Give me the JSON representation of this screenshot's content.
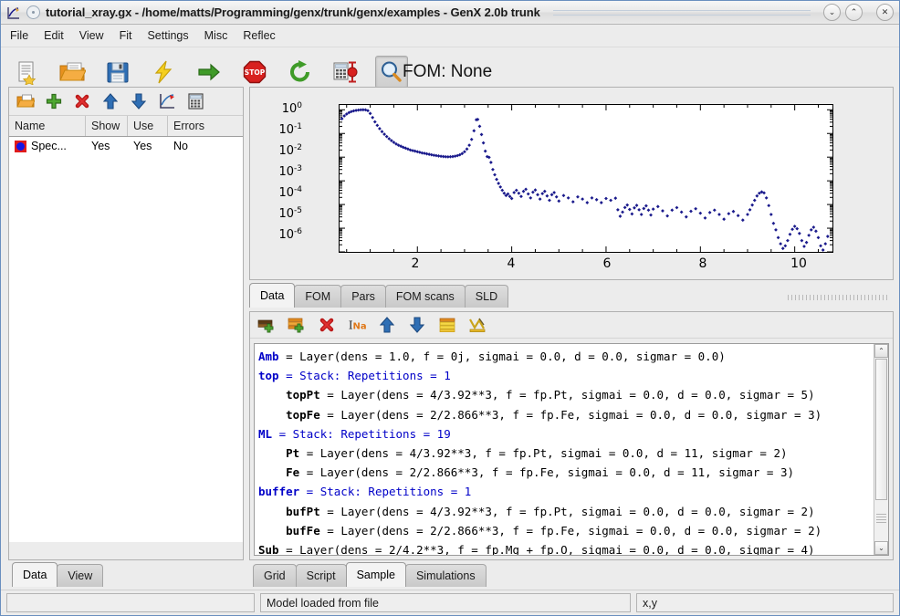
{
  "window": {
    "title": "tutorial_xray.gx - /home/matts/Programming/genx/trunk/genx/examples - GenX 2.0b trunk",
    "minimize_label": "⌄",
    "maximize_label": "⌃",
    "close_label": "✕"
  },
  "menu": {
    "items": [
      {
        "label": "File"
      },
      {
        "label": "Edit"
      },
      {
        "label": "View"
      },
      {
        "label": "Fit"
      },
      {
        "label": "Settings"
      },
      {
        "label": "Misc"
      },
      {
        "label": "Reflec"
      }
    ]
  },
  "toolbar": {
    "fom_text": "FOM: None",
    "items": [
      {
        "icon": "new-document-icon",
        "label": "New"
      },
      {
        "icon": "open-folder-icon",
        "label": "Open"
      },
      {
        "icon": "save-floppy-icon",
        "label": "Save"
      },
      {
        "icon": "lightning-simulate-icon",
        "label": "Simulate"
      },
      {
        "icon": "green-arrow-start-fit-icon",
        "label": "Start fit"
      },
      {
        "icon": "stop-sign-icon",
        "label": "Stop fit"
      },
      {
        "icon": "green-refresh-icon",
        "label": "Restart fit"
      },
      {
        "icon": "calculator-error-icon",
        "label": "Calculate errorbars"
      },
      {
        "icon": "magnifier-zoom-icon",
        "label": "Zoom",
        "pressed": true
      }
    ]
  },
  "data_panel": {
    "toolbar": [
      {
        "icon": "open-folder-icon",
        "label": "Open dataset"
      },
      {
        "icon": "green-plus-icon",
        "label": "Add dataset"
      },
      {
        "icon": "red-cross-icon",
        "label": "Delete dataset"
      },
      {
        "icon": "blue-arrow-up-icon",
        "label": "Move up"
      },
      {
        "icon": "blue-arrow-down-icon",
        "label": "Move down"
      },
      {
        "icon": "plot-settings-icon",
        "label": "Plot settings"
      },
      {
        "icon": "calculator-icon",
        "label": "Calculations"
      }
    ],
    "columns": [
      "Name",
      "Show",
      "Use",
      "Errors"
    ],
    "rows": [
      {
        "name": "Spec...",
        "show": "Yes",
        "use": "Yes",
        "errors": "No"
      }
    ]
  },
  "plot": {
    "tabs": [
      {
        "label": "Data",
        "active": true
      },
      {
        "label": "FOM",
        "active": false
      },
      {
        "label": "Pars",
        "active": false
      },
      {
        "label": "FOM scans",
        "active": false
      },
      {
        "label": "SLD",
        "active": false
      }
    ]
  },
  "chart_data": {
    "type": "scatter",
    "title": "",
    "xlabel": "",
    "ylabel": "",
    "xlim": [
      0.35,
      10.8
    ],
    "ylim": [
      1e-06,
      1.6
    ],
    "yscale": "log",
    "grid": false,
    "legend_position": "none",
    "xticks": [
      2,
      4,
      6,
      8,
      10
    ],
    "yticks": [
      1,
      0.1,
      0.01,
      0.001,
      0.0001,
      1e-05,
      1e-06
    ],
    "ytick_labels": [
      "10^0",
      "10^-1",
      "10^-2",
      "10^-3",
      "10^-4",
      "10^-5",
      "10^-6"
    ],
    "series": [
      {
        "name": "Spec",
        "color": "#1a1a8c",
        "marker": "diamond",
        "points": [
          [
            0.4,
            0.42
          ],
          [
            0.45,
            0.55
          ],
          [
            0.5,
            0.66
          ],
          [
            0.55,
            0.76
          ],
          [
            0.6,
            0.84
          ],
          [
            0.65,
            0.9
          ],
          [
            0.7,
            0.94
          ],
          [
            0.75,
            0.97
          ],
          [
            0.8,
            0.99
          ],
          [
            0.85,
            1.0
          ],
          [
            0.9,
            0.99
          ],
          [
            0.95,
            0.92
          ],
          [
            1.0,
            0.7
          ],
          [
            1.05,
            0.47
          ],
          [
            1.1,
            0.31
          ],
          [
            1.15,
            0.22
          ],
          [
            1.2,
            0.16
          ],
          [
            1.25,
            0.12
          ],
          [
            1.3,
            0.093
          ],
          [
            1.35,
            0.074
          ],
          [
            1.4,
            0.06
          ],
          [
            1.45,
            0.05
          ],
          [
            1.5,
            0.042
          ],
          [
            1.55,
            0.036
          ],
          [
            1.6,
            0.032
          ],
          [
            1.65,
            0.029
          ],
          [
            1.7,
            0.026
          ],
          [
            1.75,
            0.024
          ],
          [
            1.8,
            0.022
          ],
          [
            1.85,
            0.02
          ],
          [
            1.9,
            0.019
          ],
          [
            1.95,
            0.018
          ],
          [
            2.0,
            0.017
          ],
          [
            2.05,
            0.016
          ],
          [
            2.1,
            0.015
          ],
          [
            2.15,
            0.0145
          ],
          [
            2.2,
            0.0138
          ],
          [
            2.25,
            0.0132
          ],
          [
            2.3,
            0.0126
          ],
          [
            2.35,
            0.012
          ],
          [
            2.4,
            0.0116
          ],
          [
            2.45,
            0.0112
          ],
          [
            2.5,
            0.0109
          ],
          [
            2.55,
            0.0106
          ],
          [
            2.6,
            0.0104
          ],
          [
            2.65,
            0.0103
          ],
          [
            2.7,
            0.0104
          ],
          [
            2.75,
            0.0106
          ],
          [
            2.8,
            0.011
          ],
          [
            2.85,
            0.0116
          ],
          [
            2.9,
            0.0126
          ],
          [
            2.95,
            0.0142
          ],
          [
            3.0,
            0.017
          ],
          [
            3.05,
            0.022
          ],
          [
            3.1,
            0.032
          ],
          [
            3.15,
            0.056
          ],
          [
            3.2,
            0.13
          ],
          [
            3.25,
            0.38
          ],
          [
            3.28,
            0.39
          ],
          [
            3.32,
            0.2
          ],
          [
            3.36,
            0.09
          ],
          [
            3.4,
            0.04
          ],
          [
            3.44,
            0.018
          ],
          [
            3.48,
            0.0105
          ],
          [
            3.52,
            0.0098
          ],
          [
            3.56,
            0.006
          ],
          [
            3.6,
            0.003
          ],
          [
            3.64,
            0.0018
          ],
          [
            3.68,
            0.00115
          ],
          [
            3.72,
            0.00078
          ],
          [
            3.76,
            0.00055
          ],
          [
            3.8,
            0.0004
          ],
          [
            3.84,
            0.0003
          ],
          [
            3.88,
            0.00024
          ],
          [
            3.92,
            0.00028
          ],
          [
            3.96,
            0.00022
          ],
          [
            4.0,
            0.00018
          ],
          [
            4.05,
            0.00032
          ],
          [
            4.1,
            0.0004
          ],
          [
            4.15,
            0.0003
          ],
          [
            4.2,
            0.00022
          ],
          [
            4.25,
            0.00036
          ],
          [
            4.3,
            0.00044
          ],
          [
            4.35,
            0.00028
          ],
          [
            4.4,
            0.00019
          ],
          [
            4.45,
            0.00033
          ],
          [
            4.5,
            0.00041
          ],
          [
            4.55,
            0.00026
          ],
          [
            4.6,
            0.00017
          ],
          [
            4.65,
            0.00029
          ],
          [
            4.7,
            0.00036
          ],
          [
            4.75,
            0.00023
          ],
          [
            4.8,
            0.00015
          ],
          [
            4.85,
            0.00026
          ],
          [
            4.9,
            0.00032
          ],
          [
            4.95,
            0.00021
          ],
          [
            5.0,
            0.00014
          ],
          [
            5.1,
            0.00024
          ],
          [
            5.2,
            0.00019
          ],
          [
            5.3,
            0.00013
          ],
          [
            5.4,
            0.00021
          ],
          [
            5.5,
            0.00017
          ],
          [
            5.6,
            0.00012
          ],
          [
            5.7,
            0.00019
          ],
          [
            5.8,
            0.00016
          ],
          [
            5.9,
            0.00012
          ],
          [
            6.0,
            0.00018
          ],
          [
            6.1,
            0.00015
          ],
          [
            6.2,
            0.000185
          ],
          [
            6.25,
            6e-05
          ],
          [
            6.3,
            3.2e-05
          ],
          [
            6.35,
            4.8e-05
          ],
          [
            6.4,
            7.5e-05
          ],
          [
            6.45,
            9.5e-05
          ],
          [
            6.5,
            6.2e-05
          ],
          [
            6.55,
            4e-05
          ],
          [
            6.6,
            7.2e-05
          ],
          [
            6.65,
            9.2e-05
          ],
          [
            6.7,
            6e-05
          ],
          [
            6.75,
            3.8e-05
          ],
          [
            6.8,
            6.8e-05
          ],
          [
            6.85,
            8.8e-05
          ],
          [
            6.9,
            5.8e-05
          ],
          [
            6.95,
            3.6e-05
          ],
          [
            7.0,
            6.4e-05
          ],
          [
            7.1,
            8.2e-05
          ],
          [
            7.2,
            5.4e-05
          ],
          [
            7.3,
            3.3e-05
          ],
          [
            7.4,
            5.8e-05
          ],
          [
            7.5,
            7.4e-05
          ],
          [
            7.6,
            4.8e-05
          ],
          [
            7.7,
            3e-05
          ],
          [
            7.8,
            5.2e-05
          ],
          [
            7.9,
            6.6e-05
          ],
          [
            8.0,
            4.3e-05
          ],
          [
            8.1,
            2.7e-05
          ],
          [
            8.2,
            4.6e-05
          ],
          [
            8.3,
            5.8e-05
          ],
          [
            8.4,
            3.8e-05
          ],
          [
            8.5,
            2.4e-05
          ],
          [
            8.6,
            4.1e-05
          ],
          [
            8.7,
            5.1e-05
          ],
          [
            8.8,
            3.4e-05
          ],
          [
            8.9,
            2.2e-05
          ],
          [
            9.0,
            3.8e-05
          ],
          [
            9.05,
            6e-05
          ],
          [
            9.1,
            9.5e-05
          ],
          [
            9.15,
            0.00015
          ],
          [
            9.2,
            0.00023
          ],
          [
            9.25,
            0.0003
          ],
          [
            9.3,
            0.00034
          ],
          [
            9.35,
            0.00031
          ],
          [
            9.4,
            0.00019
          ],
          [
            9.45,
            9e-05
          ],
          [
            9.5,
            3.8e-05
          ],
          [
            9.55,
            1.6e-05
          ],
          [
            9.6,
            8.5e-06
          ],
          [
            9.65,
            4e-06
          ],
          [
            9.7,
            2.2e-06
          ],
          [
            9.75,
            1.4e-06
          ],
          [
            9.8,
            1.8e-06
          ],
          [
            9.85,
            3e-06
          ],
          [
            9.9,
            5.5e-06
          ],
          [
            9.95,
            9e-06
          ],
          [
            10.0,
            1.2e-05
          ],
          [
            10.05,
            9.5e-06
          ],
          [
            10.1,
            6e-06
          ],
          [
            10.15,
            3e-06
          ],
          [
            10.2,
            1.7e-06
          ],
          [
            10.25,
            2.5e-06
          ],
          [
            10.3,
            5e-06
          ],
          [
            10.35,
            8.5e-06
          ],
          [
            10.4,
            1.1e-05
          ],
          [
            10.45,
            7.5e-06
          ],
          [
            10.5,
            4e-06
          ],
          [
            10.55,
            1.8e-06
          ],
          [
            10.6,
            1.2e-06
          ],
          [
            10.65,
            2.2e-06
          ],
          [
            10.7,
            4.5e-06
          ],
          [
            10.72,
            5.5e-07
          ]
        ]
      }
    ]
  },
  "script_panel": {
    "toolbar": [
      {
        "icon": "add-layer-icon",
        "label": "Add layer"
      },
      {
        "icon": "add-stack-icon",
        "label": "Add stack"
      },
      {
        "icon": "delete-red-cross-icon",
        "label": "Delete"
      },
      {
        "icon": "instrument-na-icon",
        "label": "Add instrument"
      },
      {
        "icon": "blue-arrow-up-icon",
        "label": "Move up"
      },
      {
        "icon": "blue-arrow-down-icon",
        "label": "Move down"
      },
      {
        "icon": "sample-stack-icon",
        "label": "Sample plot"
      },
      {
        "icon": "edit-tool-icon",
        "label": "Edit"
      }
    ],
    "lines": [
      {
        "indent": 0,
        "name": "Amb",
        "name_style": "keyword",
        "rest": " = Layer(dens = 1.0, f = 0j, sigmai = 0.0, d = 0.0, sigmar = 0.0)",
        "rest_style": "plain"
      },
      {
        "indent": 0,
        "name": "top",
        "name_style": "keyword",
        "rest": " = Stack: Repetitions = 1",
        "rest_style": "blue"
      },
      {
        "indent": 1,
        "name": "topPt",
        "name_style": "bold",
        "rest": " = Layer(dens = 4/3.92**3, f = fp.Pt, sigmai = 0.0, d = 0.0, sigmar = 5)",
        "rest_style": "plain"
      },
      {
        "indent": 1,
        "name": "topFe",
        "name_style": "bold",
        "rest": " = Layer(dens = 2/2.866**3, f = fp.Fe, sigmai = 0.0, d = 0.0, sigmar = 3)",
        "rest_style": "plain"
      },
      {
        "indent": 0,
        "name": "ML",
        "name_style": "keyword",
        "rest": " = Stack: Repetitions = 19",
        "rest_style": "blue"
      },
      {
        "indent": 1,
        "name": "Pt",
        "name_style": "bold",
        "rest": " = Layer(dens = 4/3.92**3, f = fp.Pt, sigmai = 0.0, d = 11, sigmar = 2)",
        "rest_style": "plain"
      },
      {
        "indent": 1,
        "name": "Fe",
        "name_style": "bold",
        "rest": " = Layer(dens = 2/2.866**3, f = fp.Fe, sigmai = 0.0, d = 11, sigmar = 3)",
        "rest_style": "plain"
      },
      {
        "indent": 0,
        "name": "buffer",
        "name_style": "keyword",
        "rest": " = Stack: Repetitions = 1",
        "rest_style": "blue"
      },
      {
        "indent": 1,
        "name": "bufPt",
        "name_style": "bold",
        "rest": " = Layer(dens = 4/3.92**3, f = fp.Pt, sigmai = 0.0, d = 0.0, sigmar = 2)",
        "rest_style": "plain"
      },
      {
        "indent": 1,
        "name": "bufFe",
        "name_style": "bold",
        "rest": " = Layer(dens = 2/2.866**3, f = fp.Fe, sigmai = 0.0, d = 0.0, sigmar = 2)",
        "rest_style": "plain"
      },
      {
        "indent": 0,
        "name": "Sub",
        "name_style": "bold",
        "rest": " = Layer(dens = 2/4.2**3, f = fp.Mg + fp.O, sigmai = 0.0, d = 0.0, sigmar = 4)",
        "rest_style": "plain"
      }
    ],
    "scroll_up_label": "⌃",
    "scroll_down_label": "⌄"
  },
  "bottom_left_tabs": [
    {
      "label": "Data",
      "active": true
    },
    {
      "label": "View",
      "active": false
    }
  ],
  "bottom_right_tabs": [
    {
      "label": "Grid",
      "active": false
    },
    {
      "label": "Script",
      "active": false
    },
    {
      "label": "Sample",
      "active": true
    },
    {
      "label": "Simulations",
      "active": false
    }
  ],
  "status_bar": {
    "left": "",
    "message": "Model loaded from file",
    "coords": "x,y"
  },
  "colors": {
    "accent": "#1a1a8c",
    "window_bg": "#ececec",
    "panel_border": "#b0b0b0",
    "keyword": "#0000c8"
  }
}
